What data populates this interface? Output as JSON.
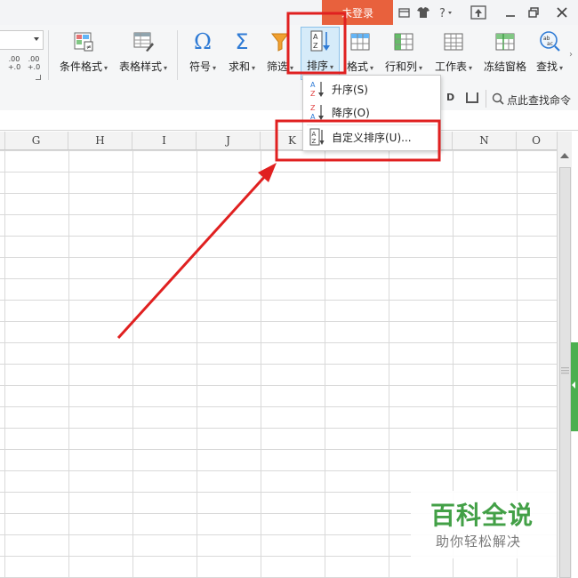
{
  "titlebar": {
    "login_label": "未登录"
  },
  "ribbon": {
    "num_format": {
      "inc_label": ".00",
      "inc_sub": "+.0",
      "dec_label": ".00",
      "dec_sub": "+.0"
    },
    "buttons": [
      {
        "label": "条件格式",
        "icon": "conditional-format-icon"
      },
      {
        "label": "表格样式",
        "icon": "table-style-icon"
      },
      {
        "label": "符号",
        "icon": "omega-icon"
      },
      {
        "label": "求和",
        "icon": "sigma-icon"
      },
      {
        "label": "筛选",
        "icon": "filter-icon"
      },
      {
        "label": "排序",
        "icon": "sort-icon"
      },
      {
        "label": "格式",
        "icon": "format-icon"
      },
      {
        "label": "行和列",
        "icon": "row-col-icon"
      },
      {
        "label": "工作表",
        "icon": "worksheet-icon"
      },
      {
        "label": "冻结窗格",
        "icon": "freeze-pane-icon"
      },
      {
        "label": "查找",
        "icon": "find-icon"
      }
    ],
    "search_command": "点此查找命令"
  },
  "sort_menu": {
    "items": [
      {
        "label": "升序(S)",
        "icon": "sort-ascending-icon"
      },
      {
        "label": "降序(O)",
        "icon": "sort-descending-icon"
      },
      {
        "label": "自定义排序(U)...",
        "icon": "custom-sort-icon"
      }
    ]
  },
  "grid": {
    "columns": [
      "G",
      "H",
      "I",
      "J",
      "K",
      "",
      "",
      "N",
      "O"
    ]
  },
  "watermark": {
    "title": "百科全说",
    "subtitle": "助你轻松解决"
  },
  "colors": {
    "login_bg": "#e8613d",
    "highlight_red": "#e02020",
    "accent_green": "#43a047",
    "sort_btn_bg": "#d6ebf9"
  }
}
